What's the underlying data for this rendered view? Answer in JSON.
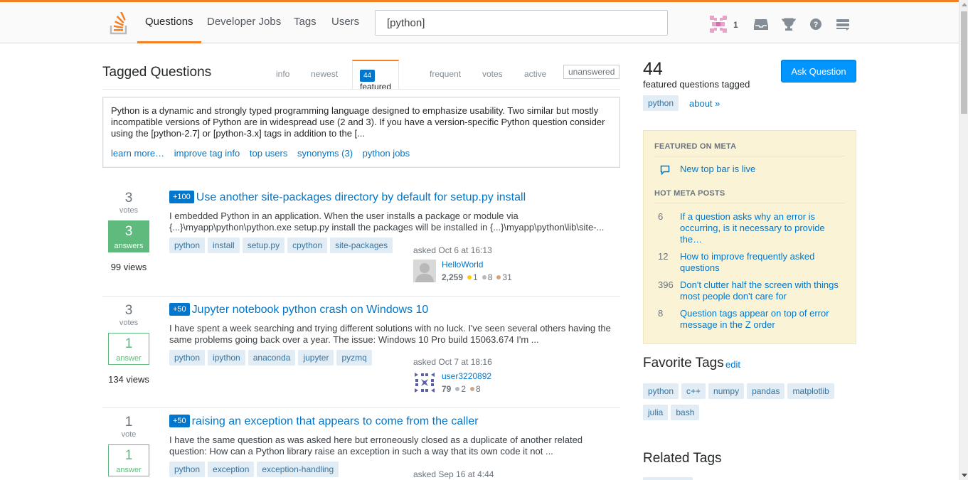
{
  "header": {
    "nav": [
      "Questions",
      "Developer Jobs",
      "Tags",
      "Users"
    ],
    "search_value": "[python]",
    "reputation": "1",
    "accent": "#f48024"
  },
  "main": {
    "title": "Tagged Questions",
    "tabs": {
      "info": "info",
      "newest": "newest",
      "featured_count": "44",
      "featured": "featured",
      "frequent": "frequent",
      "votes": "votes",
      "active": "active",
      "unanswered": "unanswered"
    },
    "wiki": {
      "text": "Python is a dynamic and strongly typed programming language designed to emphasize usability. Two similar but mostly incompatible versions of Python are in widespread use (2 and 3). If you have a version-specific Python question consider using the [python-2.7] or [python-3.x] tags in addition to the [...",
      "links": [
        "learn more…",
        "improve tag info",
        "top users",
        "synonyms (3)",
        "python jobs"
      ]
    },
    "questions": [
      {
        "votes": "3",
        "votes_label": "votes",
        "answers": "3",
        "answers_label": "answers",
        "views": "99 views",
        "bounty": "+100",
        "title": "Use another site-packages directory by default for setup.py install",
        "excerpt": "I embedded Python in an application. When the user installs a package or module via {...}\\myapp\\python\\python.exe setup.py install the packages will be installed in {...}\\myapp\\python\\lib\\site-...",
        "tags": [
          "python",
          "install",
          "setup.py",
          "cpython",
          "site-packages"
        ],
        "asked": "asked Oct 6 at 16:13",
        "user": "HelloWorld",
        "rep": "2,259",
        "gold": "1",
        "silver": "8",
        "bronze": "31"
      },
      {
        "votes": "3",
        "votes_label": "votes",
        "answers": "1",
        "answers_label": "answer",
        "views": "134 views",
        "bounty": "+50",
        "title": "Jupyter notebook python crash on Windows 10",
        "excerpt": "I have spent a week searching and trying different solutions with no luck. I've seen several others having the same problems going back over a year. The issue: Windows 10 Pro build 15063.674 I'm ...",
        "tags": [
          "python",
          "ipython",
          "anaconda",
          "jupyter",
          "pyzmq"
        ],
        "asked": "asked Oct 7 at 18:16",
        "user": "user3220892",
        "rep": "79",
        "silver": "2",
        "bronze": "8"
      },
      {
        "votes": "1",
        "votes_label": "vote",
        "answers": "1",
        "answers_label": "answer",
        "bounty": "+50",
        "title": "raising an exception that appears to come from the caller",
        "excerpt": "I have the same question as was asked here but erroneously closed as a duplicate of another related question: How can a Python library raise an exception in such a way that its own code it not ...",
        "tags": [
          "python",
          "exception",
          "exception-handling"
        ],
        "asked": "asked Sep 16 at 4:44"
      }
    ]
  },
  "sidebar": {
    "count": "44",
    "subtitle": "featured questions tagged",
    "tag": "python",
    "about": "about »",
    "ask_button": "Ask Question",
    "featured_heading": "FEATURED ON META",
    "featured_link": "New top bar is live",
    "hot_heading": "HOT META POSTS",
    "hot": [
      {
        "num": "6",
        "text": "If a question asks why an error is occurring, is it necessary to provide the…"
      },
      {
        "num": "12",
        "text": "How to improve frequently asked questions"
      },
      {
        "num": "396",
        "text": "Don't clutter half the screen with things most people don't care for"
      },
      {
        "num": "8",
        "text": "Question tags appear on top of error message in the Z order"
      }
    ],
    "favorite_title": "Favorite Tags",
    "favorite_edit": "edit",
    "favorite_tags": [
      "python",
      "c++",
      "numpy",
      "pandas",
      "matplotlib",
      "julia",
      "bash"
    ],
    "related_title": "Related Tags"
  }
}
